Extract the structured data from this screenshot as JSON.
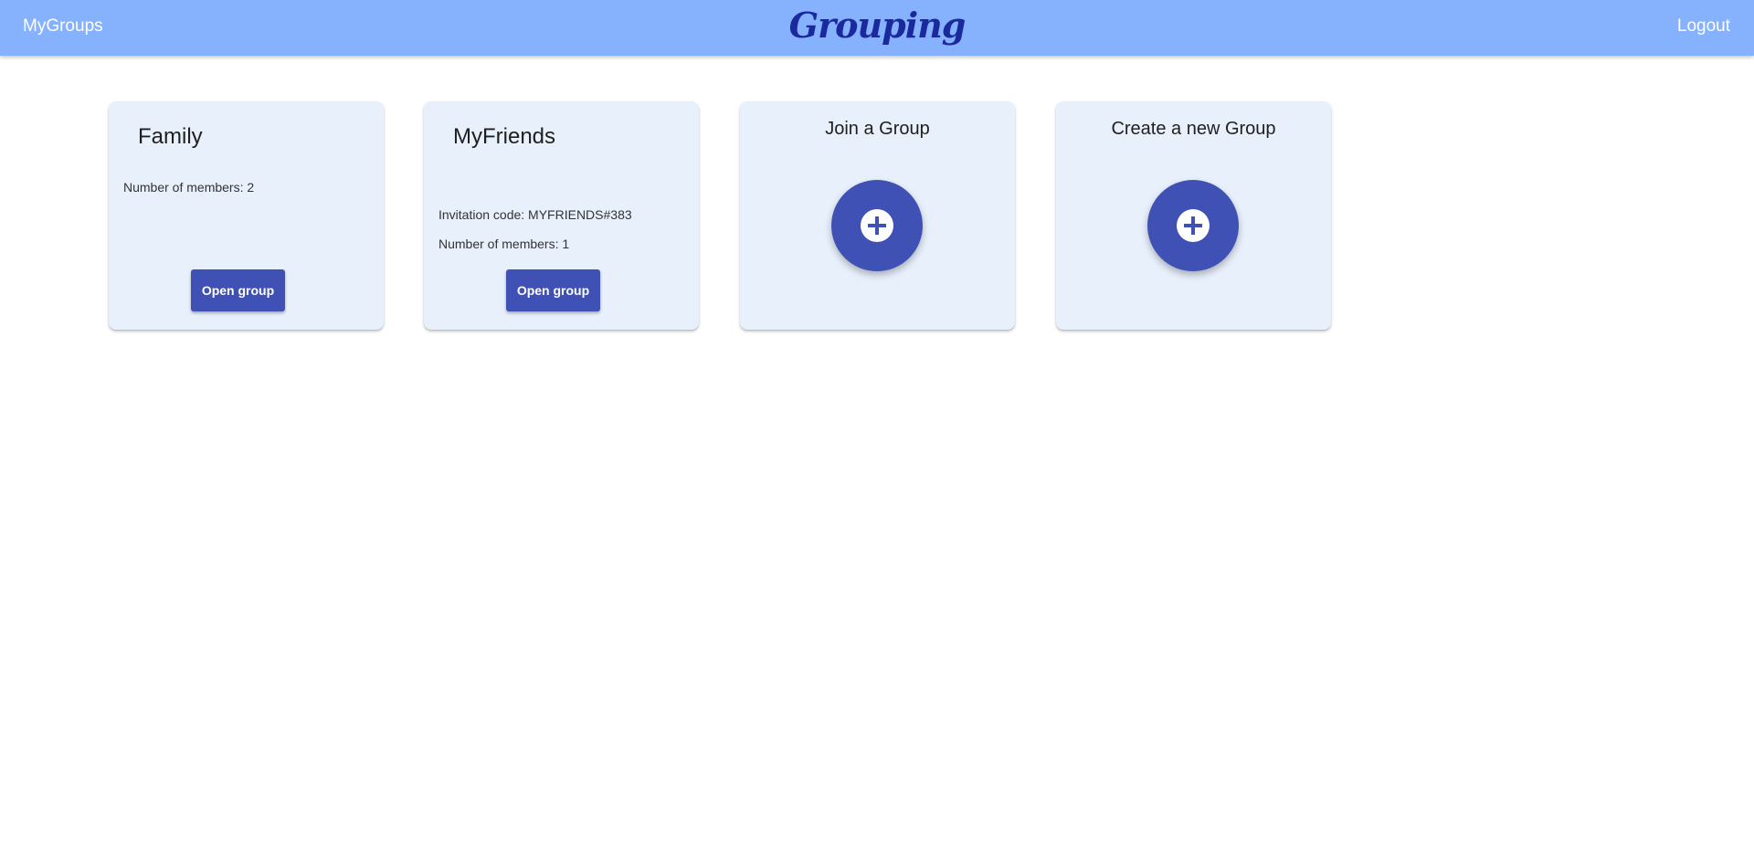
{
  "header": {
    "nav_left": "MyGroups",
    "brand": "Grouping",
    "nav_right": "Logout"
  },
  "groups": [
    {
      "name": "Family",
      "invitation_code": "",
      "members_text": "Number of members: 2",
      "button_label": "Open group"
    },
    {
      "name": "MyFriends",
      "invitation_code": "Invitation code: MYFRIENDS#383",
      "members_text": "Number of members: 1",
      "button_label": "Open group"
    }
  ],
  "actions": {
    "join": {
      "title": "Join a Group",
      "icon": "add-circle-icon"
    },
    "create": {
      "title": "Create a new Group",
      "icon": "add-circle-icon"
    }
  },
  "colors": {
    "header_bg": "#86b1fc",
    "brand": "#1a2a9c",
    "card_bg": "#e8f0fc",
    "primary": "#3f51b5"
  }
}
